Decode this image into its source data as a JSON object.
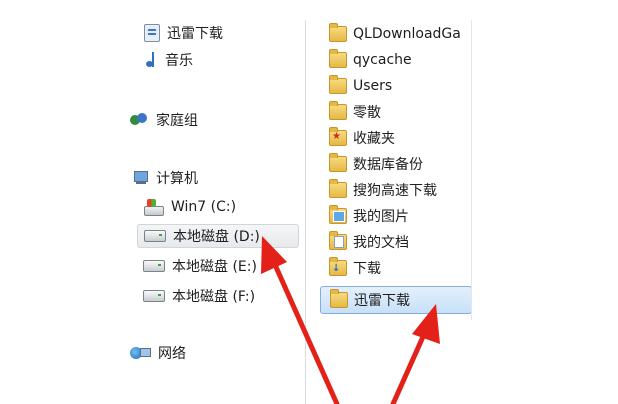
{
  "navigation": {
    "items": [
      {
        "label": "迅雷下载",
        "icon": "download-folder-icon"
      },
      {
        "label": "音乐",
        "icon": "music-icon"
      },
      {
        "label": "家庭组",
        "icon": "homegroup-icon"
      },
      {
        "label": "计算机",
        "icon": "computer-icon"
      },
      {
        "label": "Win7 (C:)",
        "icon": "system-drive-icon"
      },
      {
        "label": "本地磁盘 (D:)",
        "icon": "drive-icon",
        "selected": true
      },
      {
        "label": "本地磁盘 (E:)",
        "icon": "drive-icon"
      },
      {
        "label": "本地磁盘 (F:)",
        "icon": "drive-icon"
      },
      {
        "label": "网络",
        "icon": "network-icon"
      }
    ]
  },
  "files": [
    {
      "label": "QLDownloadGa",
      "icon": "folder-icon"
    },
    {
      "label": "qycache",
      "icon": "folder-icon"
    },
    {
      "label": "Users",
      "icon": "folder-icon"
    },
    {
      "label": "零散",
      "icon": "folder-icon"
    },
    {
      "label": "收藏夹",
      "icon": "favorites-folder-icon"
    },
    {
      "label": "数据库备份",
      "icon": "folder-icon"
    },
    {
      "label": "搜狗高速下载",
      "icon": "folder-icon"
    },
    {
      "label": "我的图片",
      "icon": "pictures-folder-icon"
    },
    {
      "label": "我的文档",
      "icon": "documents-folder-icon"
    },
    {
      "label": "下载",
      "icon": "downloads-folder-icon"
    },
    {
      "label": "迅雷下载",
      "icon": "folder-icon",
      "selected": true
    }
  ],
  "colors": {
    "selection_fill": "#c7e0f8",
    "selection_border": "#84acdd",
    "arrow": "#e32119"
  }
}
